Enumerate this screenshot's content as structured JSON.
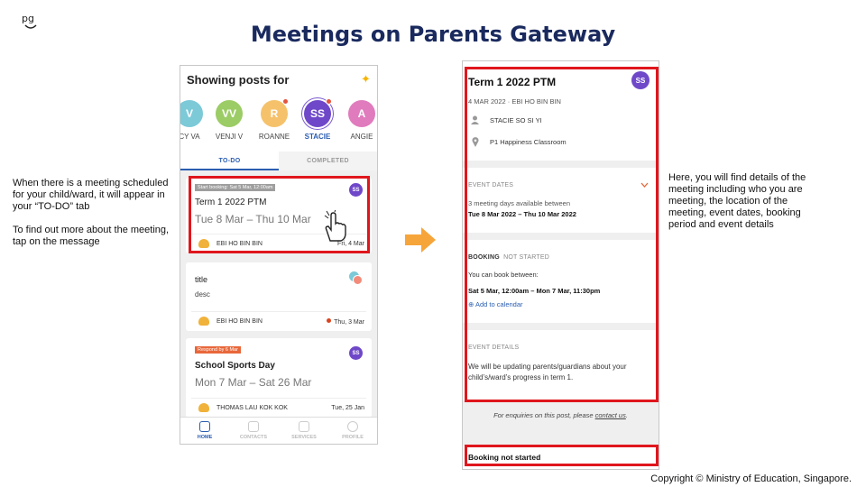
{
  "slide": {
    "logo": "pg",
    "title": "Meetings on Parents Gateway",
    "left_note_1": "When there is a meeting scheduled for your child/ward, it will appear in your “TO-DO” tab",
    "left_note_2": "To find out more about the meeting, tap on the message",
    "right_note": "Here, you will find details of the meeting including who you are meeting, the location of the meeting, event dates, booking period and event details",
    "copyright": "Copyright © Ministry of Education, Singapore."
  },
  "phone1": {
    "header": "Showing posts for",
    "avatars": [
      {
        "initials": "V",
        "name": "CY VA",
        "color": "#7cc9d8",
        "dot": false
      },
      {
        "initials": "VV",
        "name": "VENJI V",
        "color": "#9ccc65",
        "dot": false
      },
      {
        "initials": "R",
        "name": "ROANNE",
        "color": "#f5c26b",
        "dot": true
      },
      {
        "initials": "SS",
        "name": "STACIE",
        "color": "#6f48c9",
        "dot": true
      },
      {
        "initials": "A",
        "name": "ANGIE",
        "color": "#e07bbd",
        "dot": false
      }
    ],
    "tabs": {
      "todo": "TO-DO",
      "completed": "COMPLETED"
    },
    "cards": [
      {
        "tag": "Start booking: Sat 5 Mar, 12:00am",
        "title": "Term 1 2022 PTM",
        "subtitle": "Tue 8 Mar – Thu 10 Mar",
        "sender": "EBI HO BIN BIN",
        "date": "Fri, 4 Mar",
        "badge": "SS"
      },
      {
        "title": "title",
        "desc": "desc",
        "sender": "EBI HO BIN BIN",
        "date": "Thu, 3 Mar"
      },
      {
        "tag": "Respond by 6 Mar",
        "title": "School Sports Day",
        "subtitle": "Mon 7 Mar – Sat 26 Mar",
        "sender": "THOMAS LAU KOK KOK",
        "date": "Tue, 25 Jan",
        "badge": "SS"
      }
    ],
    "nav": [
      "HOME",
      "CONTACTS",
      "SERVICES",
      "PROFILE"
    ]
  },
  "phone2": {
    "title": "Term 1 2022 PTM",
    "badge": "SS",
    "meta": "4 MAR 2022 · EBI HO BIN BIN",
    "person": "STACIE SO SI YI",
    "location": "P1 Happiness Classroom",
    "event_dates": {
      "heading": "EVENT DATES",
      "line": "3 meeting days available between",
      "range": "Tue 8 Mar 2022 – Thu 10 Mar 2022"
    },
    "booking": {
      "heading": "BOOKING",
      "status": "NOT STARTED",
      "line": "You can book between:",
      "range": "Sat 5 Mar, 12:00am – Mon 7 Mar, 11:30pm",
      "calendar": "Add to calendar"
    },
    "event_details": {
      "heading": "EVENT DETAILS",
      "text": "We will be updating parents/guardians about your child’s/ward’s progress in term 1."
    },
    "enquiries_prefix": "For enquiries on this post, please ",
    "enquiries_link": "contact us",
    "enquiries_suffix": ".",
    "footer_status": "Booking not started"
  }
}
